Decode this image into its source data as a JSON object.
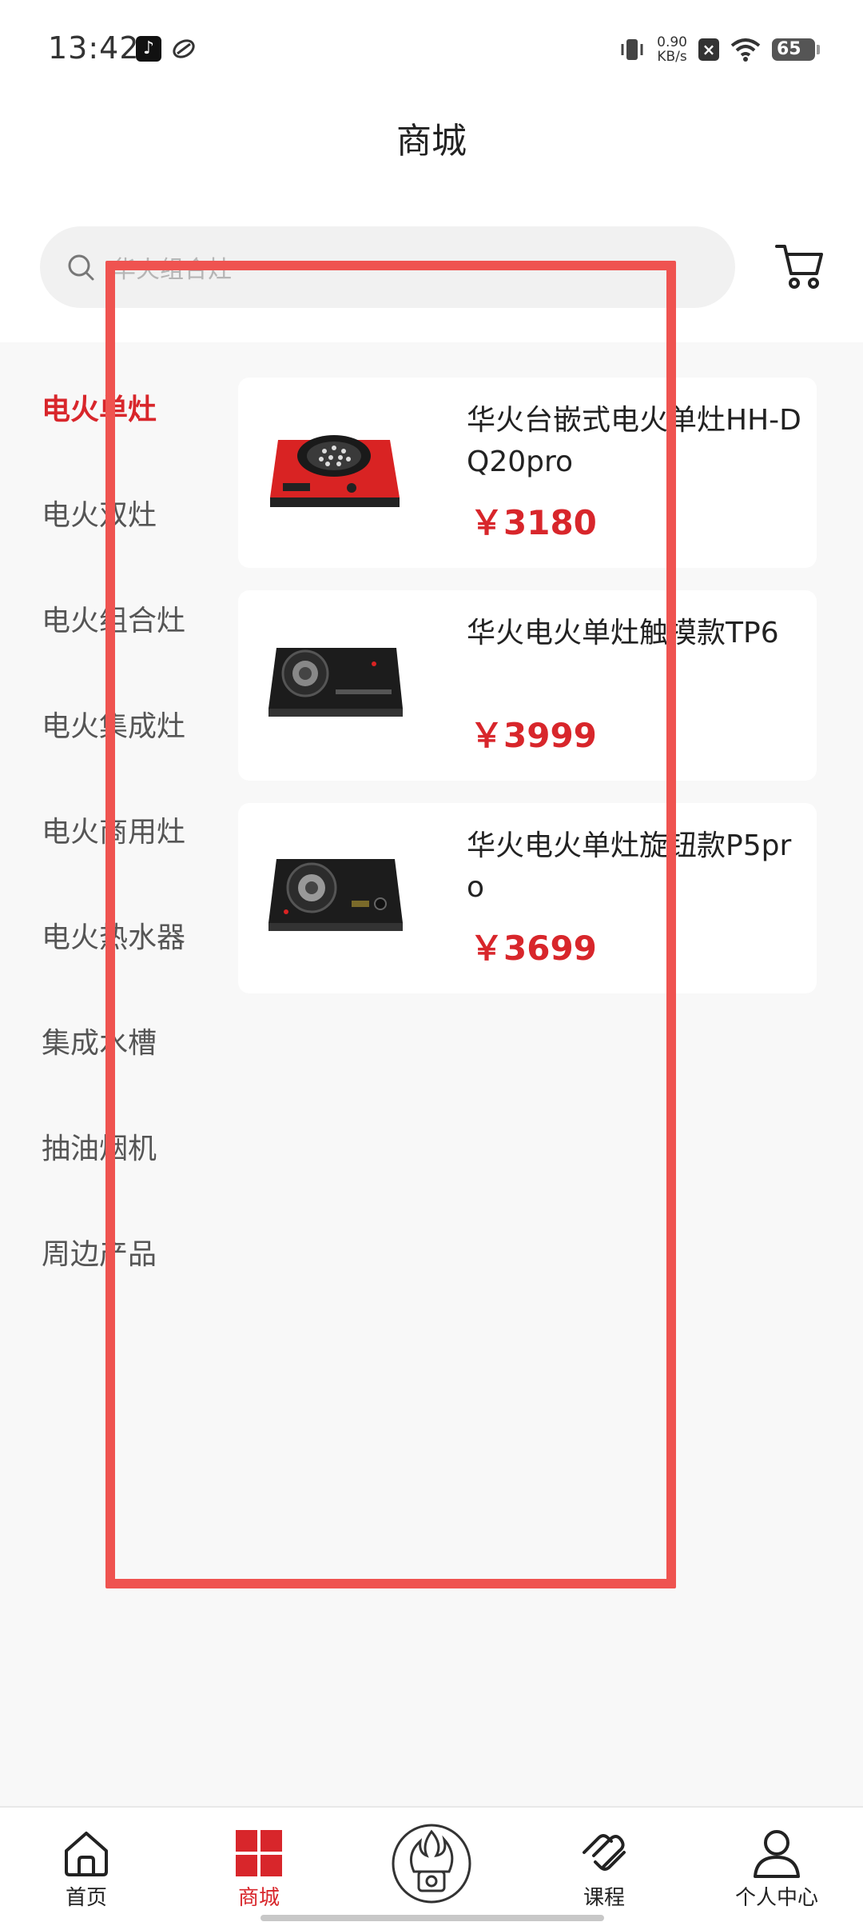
{
  "status_bar": {
    "time": "13:42",
    "speed_value": "0.90",
    "speed_unit": "KB/s",
    "battery": "65"
  },
  "header": {
    "title": "商城"
  },
  "search": {
    "placeholder": "华火组合灶"
  },
  "categories": [
    {
      "label": "电火单灶",
      "active": true
    },
    {
      "label": "电火双灶",
      "active": false
    },
    {
      "label": "电火组合灶",
      "active": false
    },
    {
      "label": "电火集成灶",
      "active": false
    },
    {
      "label": "电火商用灶",
      "active": false
    },
    {
      "label": "电火热水器",
      "active": false
    },
    {
      "label": "集成水槽",
      "active": false
    },
    {
      "label": "抽油烟机",
      "active": false
    },
    {
      "label": "周边产品",
      "active": false
    }
  ],
  "products": [
    {
      "name": "华火台嵌式电火单灶HH-DQ20pro",
      "price": "￥3180",
      "image": "red-single-burner-stove"
    },
    {
      "name": "华火电火单灶触摸款TP6",
      "price": "￥3999",
      "image": "black-touch-stove"
    },
    {
      "name": "华火电火单灶旋钮款P5pro",
      "price": "￥3699",
      "image": "black-knob-stove"
    }
  ],
  "tabbar": {
    "items": [
      {
        "label": "首页",
        "icon": "home-icon",
        "active": false
      },
      {
        "label": "商城",
        "icon": "grid-icon",
        "active": true
      },
      {
        "label": "",
        "icon": "brand-logo-icon",
        "active": false
      },
      {
        "label": "课程",
        "icon": "course-icon",
        "active": false
      },
      {
        "label": "个人中心",
        "icon": "person-icon",
        "active": false
      }
    ]
  },
  "colors": {
    "accent": "#d8262b",
    "annotation": "#ef5350",
    "content_bg": "#f8f8f8"
  }
}
